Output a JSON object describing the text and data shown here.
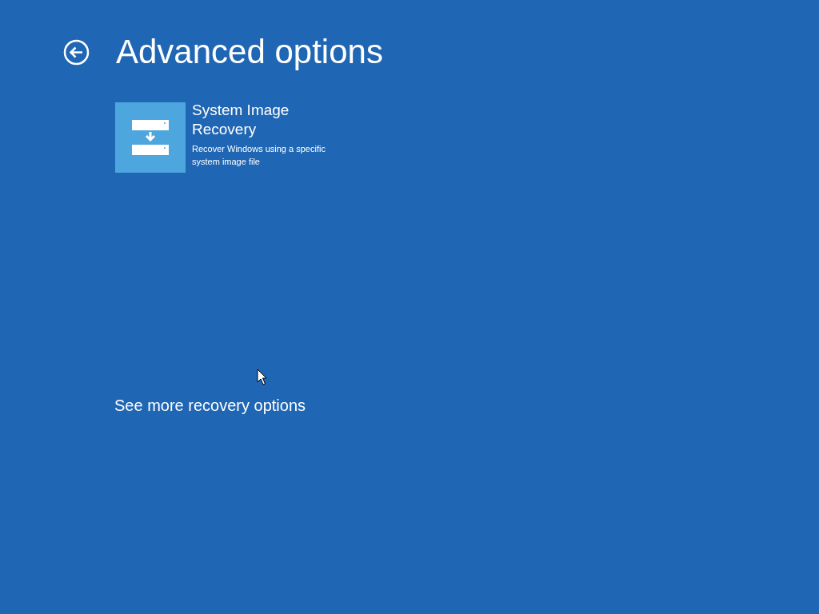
{
  "title": "Advanced options",
  "options": [
    {
      "title": "System Image Recovery",
      "description": "Recover Windows using a specific system image file"
    }
  ],
  "more_link": "See more recovery options"
}
